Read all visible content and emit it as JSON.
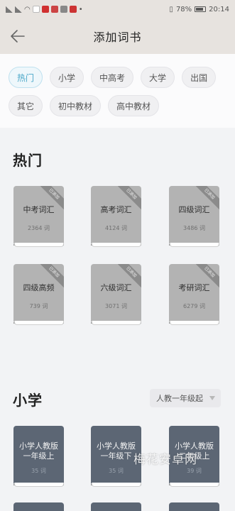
{
  "status_bar": {
    "battery": "78%",
    "time": "20:14"
  },
  "header": {
    "title": "添加词书"
  },
  "chips": [
    {
      "label": "热门",
      "active": true
    },
    {
      "label": "小学"
    },
    {
      "label": "中高考"
    },
    {
      "label": "大学"
    },
    {
      "label": "出国"
    },
    {
      "label": "其它"
    },
    {
      "label": "初中教材"
    },
    {
      "label": "高中教材"
    }
  ],
  "sections": {
    "hot": {
      "title": "热门",
      "books": [
        {
          "name": "中考词汇",
          "count": "2364 词",
          "badge": "已添加"
        },
        {
          "name": "高考词汇",
          "count": "4124 词",
          "badge": "已添加"
        },
        {
          "name": "四级词汇",
          "count": "3486 词",
          "badge": "已添加"
        },
        {
          "name": "四级高频",
          "count": "739 词",
          "badge": "已添加"
        },
        {
          "name": "六级词汇",
          "count": "3071 词",
          "badge": "已添加"
        },
        {
          "name": "考研词汇",
          "count": "6279 词",
          "badge": "已添加"
        }
      ]
    },
    "primary": {
      "title": "小学",
      "grade_filter": "人教一年级起",
      "books": [
        {
          "name_line1": "小学人教版",
          "name_line2": "一年级上",
          "count": "35 词"
        },
        {
          "name_line1": "小学人教版",
          "name_line2": "一年级下",
          "count": "35 词"
        },
        {
          "name_line1": "小学人教版",
          "name_line2": "二年级上",
          "count": "39 词"
        }
      ]
    }
  },
  "watermark": "梅花安卓网",
  "colors": {
    "header_bg": "#e7e3df",
    "accent": "#4aa7c8",
    "book_grey": "#b3b3b3",
    "book_dark": "#5c6674"
  }
}
